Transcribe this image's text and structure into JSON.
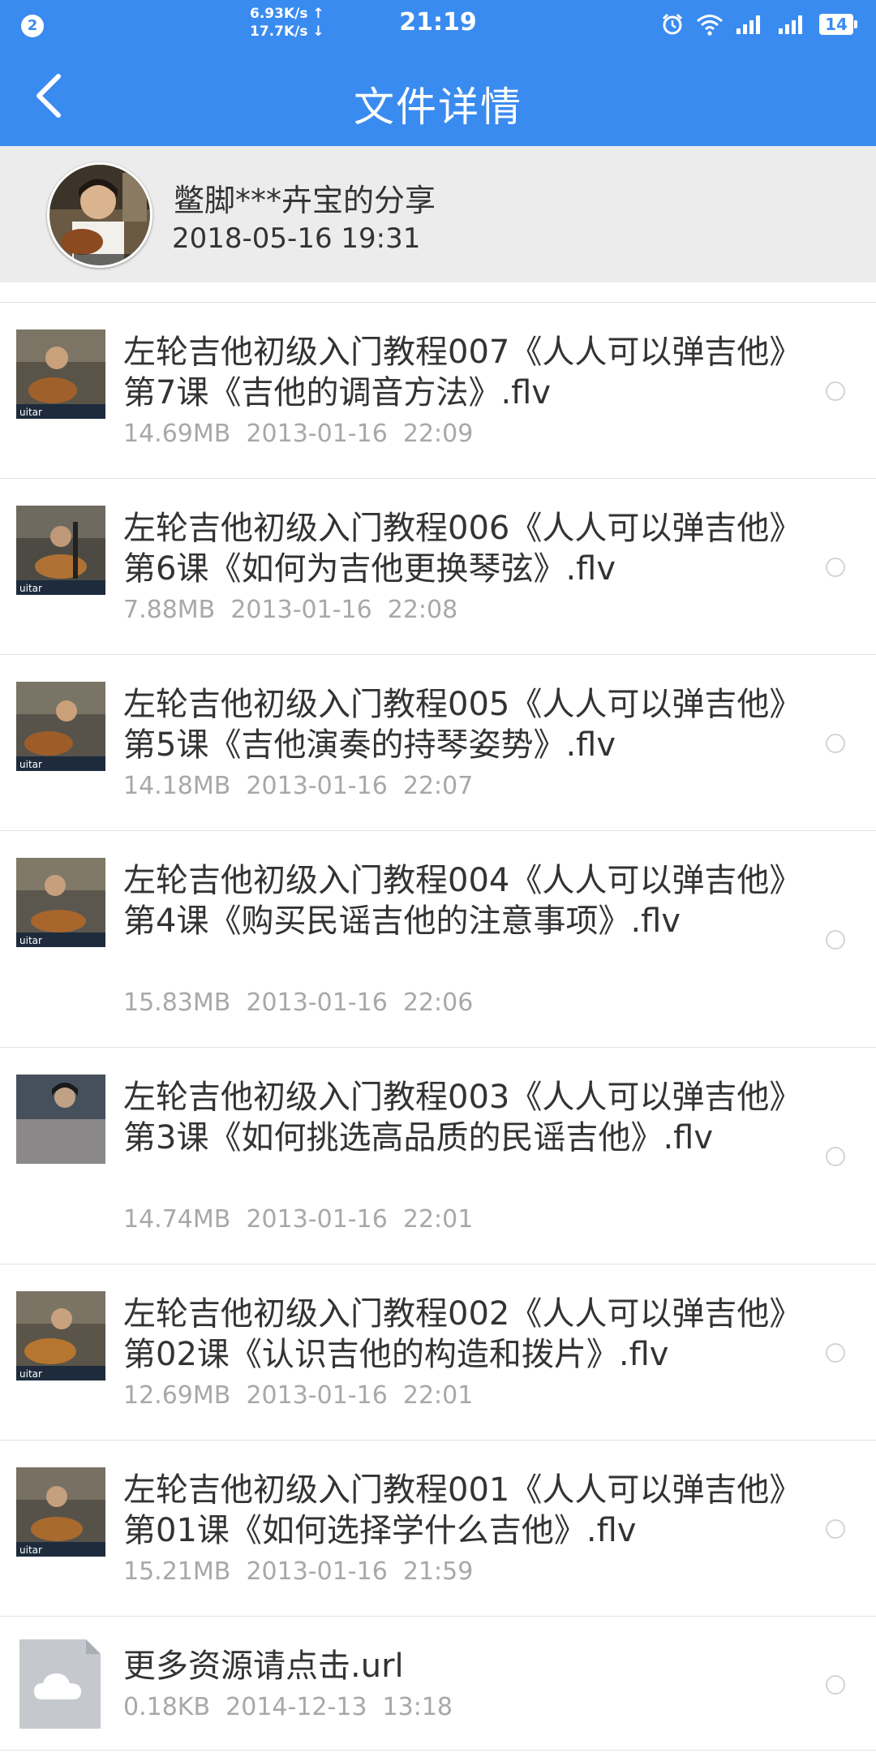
{
  "status_bar": {
    "notification_count": "2",
    "upload_speed": "6.93K/s ↑",
    "download_speed": "17.7K/s ↓",
    "time": "21:19",
    "battery": "14",
    "icons": [
      "alarm-icon",
      "wifi-icon",
      "signal-icon",
      "signal-icon"
    ]
  },
  "header": {
    "title": "文件详情",
    "back_icon": "back-arrow-icon"
  },
  "share": {
    "sharer": "鳖脚***卉宝的分享",
    "date": "2018-05-16  19:31"
  },
  "files": [
    {
      "name": "左轮吉他初级入门教程007《人人可以弹吉他》第7课《吉他的调音方法》.flv",
      "size": "14.69MB",
      "date": "2013-01-16  22:09",
      "type": "video"
    },
    {
      "name": "左轮吉他初级入门教程006《人人可以弹吉他》第6课《如何为吉他更换琴弦》.flv",
      "size": "7.88MB",
      "date": "2013-01-16  22:08",
      "type": "video"
    },
    {
      "name": "左轮吉他初级入门教程005《人人可以弹吉他》第5课《吉他演奏的持琴姿势》.flv",
      "size": "14.18MB",
      "date": "2013-01-16  22:07",
      "type": "video"
    },
    {
      "name": "左轮吉他初级入门教程004《人人可以弹吉他》第4课《购买民谣吉他的注意事项》.flv",
      "size": "15.83MB",
      "date": "2013-01-16  22:06",
      "type": "video"
    },
    {
      "name": "左轮吉他初级入门教程003《人人可以弹吉他》第3课《如何挑选高品质的民谣吉他》.flv",
      "size": "14.74MB",
      "date": "2013-01-16  22:01",
      "type": "video"
    },
    {
      "name": "左轮吉他初级入门教程002《人人可以弹吉他》第02课《认识吉他的构造和拨片》.flv",
      "size": "12.69MB",
      "date": "2013-01-16  22:01",
      "type": "video"
    },
    {
      "name": "左轮吉他初级入门教程001《人人可以弹吉他》第01课《如何选择学什么吉他》.flv",
      "size": "15.21MB",
      "date": "2013-01-16  21:59",
      "type": "video"
    },
    {
      "name": "更多资源请点击.url",
      "size": "0.18KB",
      "date": "2014-12-13  13:18",
      "type": "link"
    }
  ],
  "colors": {
    "primary": "#3a8bef",
    "header_bg": "#ececec",
    "meta_text": "#a8a8a8"
  }
}
